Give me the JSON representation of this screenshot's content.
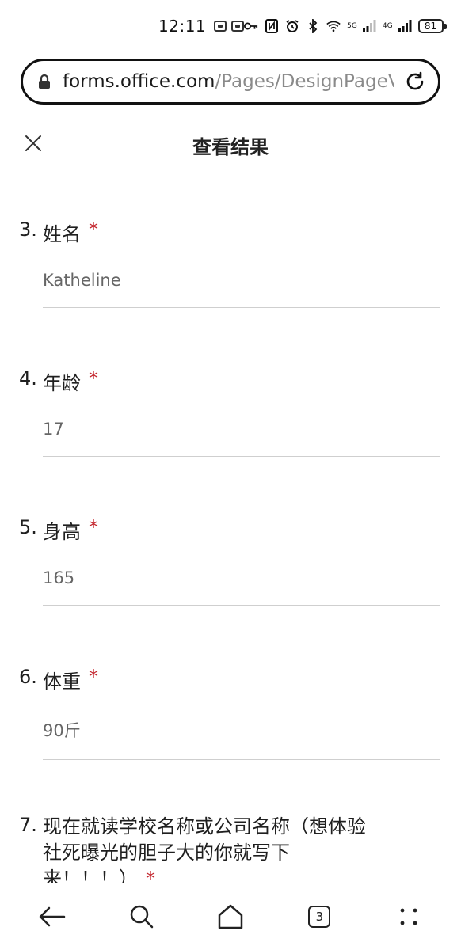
{
  "status_bar": {
    "time": "12:11",
    "net1": "5G",
    "net2": "4G",
    "battery": "81"
  },
  "browser": {
    "url_domain": "forms.office.com",
    "url_path": "/Pages/DesignPageV"
  },
  "header": {
    "title": "查看结果"
  },
  "questions": [
    {
      "number": "3.",
      "label": "姓名",
      "required": "*",
      "answer": "Katheline"
    },
    {
      "number": "4.",
      "label": "年龄",
      "required": "*",
      "answer": "17"
    },
    {
      "number": "5.",
      "label": "身高",
      "required": "*",
      "answer": "165"
    },
    {
      "number": "6.",
      "label": "体重",
      "required": "*",
      "answer": "90斤"
    },
    {
      "number": "7.",
      "label_line1": "现在就读学校名称或公司名称（想体验",
      "label_line2": "社死曝光的胆子大的你就写下",
      "label_line3": "来！！！）",
      "required": "*"
    }
  ],
  "bottom_nav": {
    "tabs_count": "3"
  },
  "icons": {
    "lock": "lock-icon",
    "reload": "reload-icon",
    "close": "close-icon",
    "back": "back-arrow-icon",
    "search": "search-icon",
    "home": "home-icon",
    "tabs": "tabs-icon",
    "menu": "menu-dots-icon"
  },
  "colors": {
    "required": "#c4262e",
    "answer_text": "#666666",
    "url_path": "#8a8a8a"
  }
}
